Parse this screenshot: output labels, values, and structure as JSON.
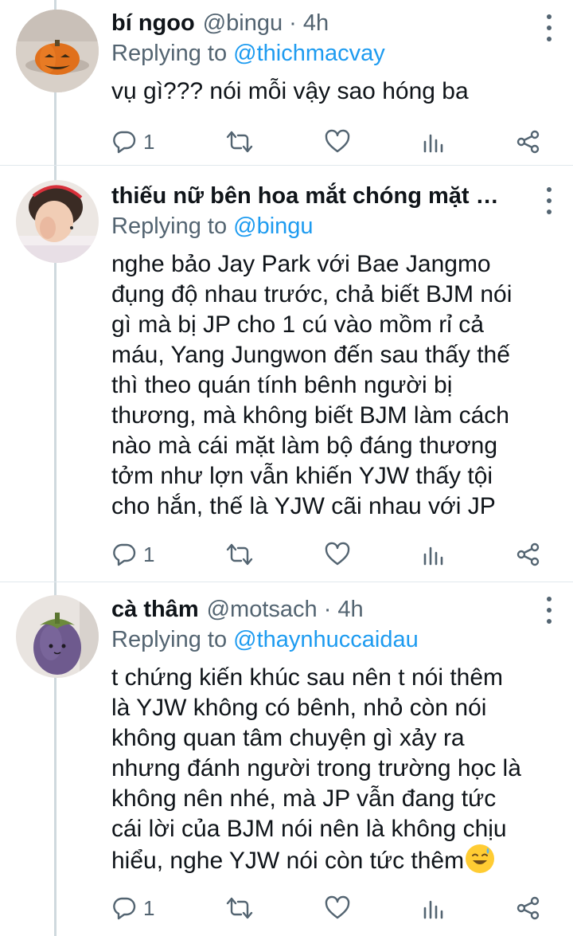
{
  "colors": {
    "accent": "#1d9bf0",
    "muted": "#536471",
    "text": "#0f1419"
  },
  "tweets": [
    {
      "name": "bí ngoo",
      "handle": "@bingu · 4h",
      "replying_prefix": "Replying to ",
      "replying_to": "@thichmacvay",
      "text": "vụ gì??? nói mỗi vậy sao hóng ba",
      "reply_count": "1",
      "avatar_icon": "pumpkin-avatar"
    },
    {
      "name": "thiếu nữ bên hoa mắt chóng mặt …",
      "handle": "",
      "replying_prefix": "Replying to ",
      "replying_to": "@bingu",
      "text": "nghe bảo Jay Park với Bae Jangmo\nđụng độ nhau trước, chả biết BJM nói\ngì mà bị JP cho 1 cú vào mồm rỉ cả\nmáu, Yang Jungwon đến sau thấy thế\nthì theo quán tính bênh người bị\nthương, mà không biết BJM làm cách\nnào mà cái mặt làm bộ đáng thương\ntởm như lợn vẫn khiến YJW thấy tội\ncho hắn, thế là YJW cãi nhau với JP",
      "reply_count": "1",
      "avatar_icon": "girl-avatar"
    },
    {
      "name": "cà thâm",
      "handle": "@motsach · 4h",
      "replying_prefix": "Replying to ",
      "replying_to": "@thaynhuccaidau",
      "text": "t chứng kiến khúc sau nên t nói thêm\nlà YJW không có bênh, nhỏ còn nói\nkhông quan tâm chuyện gì xảy ra\nnhưng đánh người trong trường học là\nkhông nên nhé, mà JP vẫn đang tức\ncái lời của BJM nói nên là không chịu\nhiểu, nghe YJW nói còn tức thêm",
      "reply_count": "1",
      "avatar_icon": "eggplant-avatar"
    }
  ]
}
